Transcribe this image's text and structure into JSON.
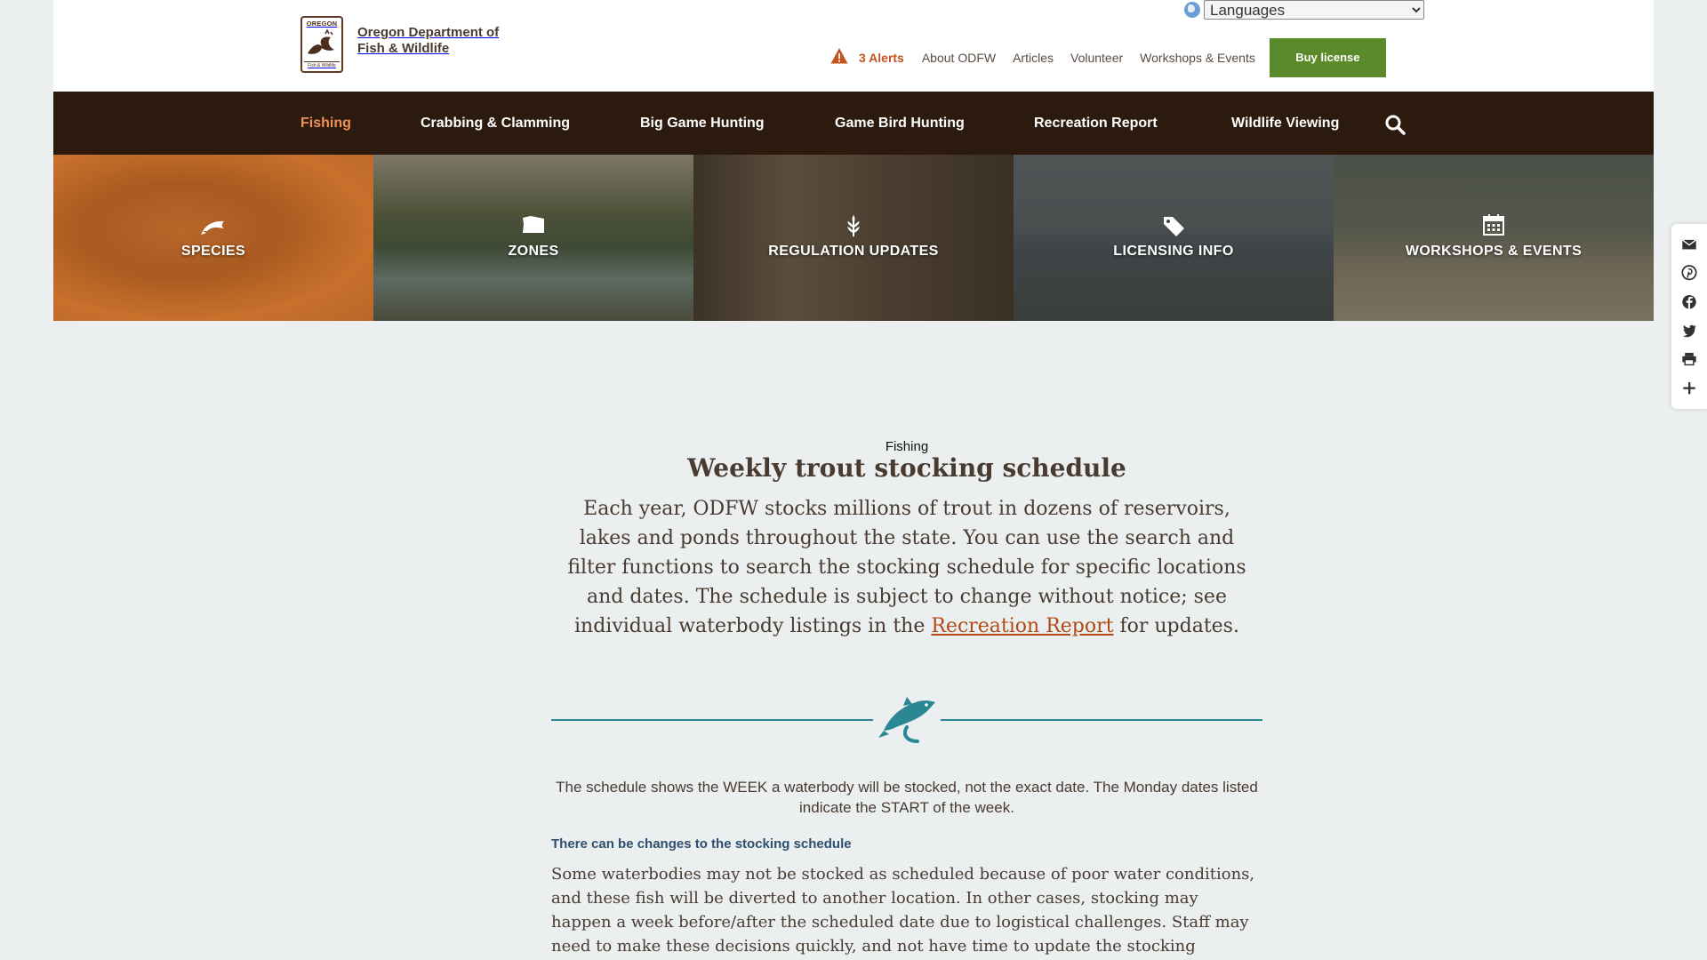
{
  "site": {
    "logo_top": "OREGON",
    "logo_bottom": "Fish & Wildlife",
    "name_line1": "Oregon Department of",
    "name_line2": "Fish & Wildlife"
  },
  "language": {
    "selected": "Languages"
  },
  "utility": {
    "alerts": "3 Alerts",
    "links": [
      "About ODFW",
      "Articles",
      "Volunteer",
      "Workshops & Events"
    ],
    "buy_license": "Buy license"
  },
  "nav": {
    "items": [
      "Fishing",
      "Crabbing & Clamming",
      "Big Game Hunting",
      "Game Bird Hunting",
      "Recreation Report",
      "Wildlife Viewing"
    ],
    "active": "Fishing"
  },
  "tiles": [
    {
      "label": "SPECIES",
      "icon": "fish-icon"
    },
    {
      "label": "ZONES",
      "icon": "oregon-map-icon"
    },
    {
      "label": "REGULATION UPDATES",
      "icon": "wheat-icon"
    },
    {
      "label": "LICENSING INFO",
      "icon": "tag-icon"
    },
    {
      "label": "WORKSHOPS & EVENTS",
      "icon": "calendar-icon"
    }
  ],
  "share": [
    "email-icon",
    "pinterest-icon",
    "facebook-icon",
    "twitter-icon",
    "print-icon",
    "plus-icon"
  ],
  "content": {
    "breadcrumb": "Fishing",
    "title": "Weekly trout stocking schedule",
    "intro_before": "Each year, ODFW stocks millions of trout in dozens of reservoirs, lakes and ponds throughout the state. You can use the search and filter functions to search the stocking schedule for specific locations and dates. The schedule is subject to change without notice; see individual waterbody listings in the ",
    "intro_link": "Recreation Report",
    "intro_after": " for updates.",
    "note": "The schedule shows the WEEK a waterbody will be stocked, not the exact date. The Monday dates listed indicate the START of the week.",
    "subhead": "There can be changes to the stocking schedule",
    "paragraph": "Some waterbodies may not be stocked as scheduled because of poor water conditions, and these fish will be diverted to another location. In other cases, stocking may happen a week before/after the scheduled date due to logistical challenges. Staff may need to make these decisions quickly, and not have time to update the stocking database."
  },
  "colors": {
    "nav_bg": "#2c1a0e",
    "accent_orange": "#f0915a",
    "alert_orange": "#c4521f",
    "buy_green": "#5b8a2b",
    "divider_teal": "#2b8793",
    "page_bg": "#ebeff0"
  }
}
